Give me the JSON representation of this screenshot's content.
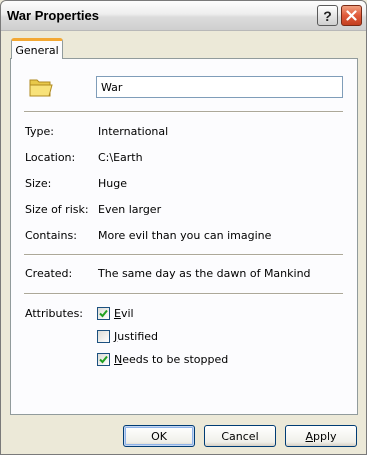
{
  "window": {
    "title": "War Properties"
  },
  "titlebar": {
    "help_glyph": "?",
    "close_glyph": "×"
  },
  "tabs": [
    {
      "label": "General",
      "active": true
    }
  ],
  "general": {
    "icon": "folder-icon",
    "name_value": "War",
    "properties": [
      {
        "label": "Type:",
        "value": "International"
      },
      {
        "label": "Location:",
        "value": "C:\\Earth"
      },
      {
        "label": "Size:",
        "value": "Huge"
      },
      {
        "label": "Size of risk:",
        "value": "Even larger"
      },
      {
        "label": "Contains:",
        "value": "More evil than you can imagine"
      }
    ],
    "created": {
      "label": "Created:",
      "value": "The same day as the dawn of Mankind"
    },
    "attributes": {
      "label": "Attributes:",
      "items": [
        {
          "label_first": "E",
          "label_rest": "vil",
          "checked": true
        },
        {
          "label_first": "J",
          "label_rest": "ustified",
          "checked": false
        },
        {
          "label_first": "N",
          "label_rest": "eeds to be stopped",
          "checked": true
        }
      ]
    }
  },
  "buttons": {
    "ok": "OK",
    "cancel": "Cancel",
    "apply_first": "A",
    "apply_rest": "pply"
  },
  "colors": {
    "tab_accent": "#f3a833",
    "close_button": "#e05a3a",
    "check": "#21a121",
    "button_border": "#003c74"
  }
}
